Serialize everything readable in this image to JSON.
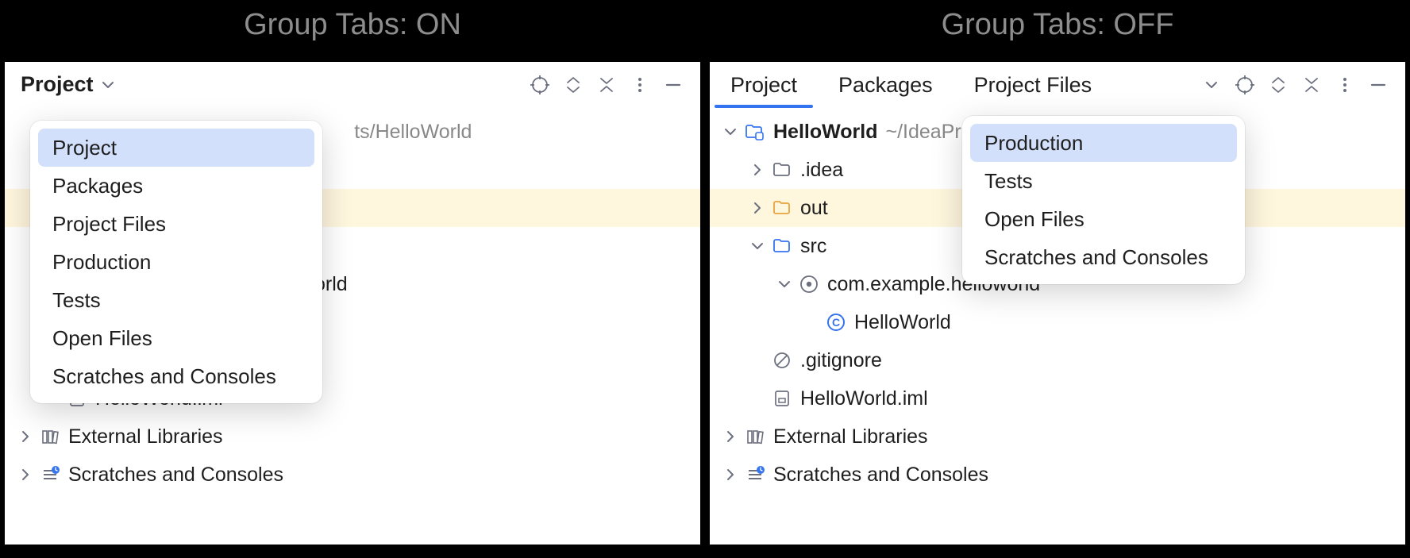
{
  "captions": {
    "left": "Group Tabs: ON",
    "right": "Group Tabs: OFF"
  },
  "left": {
    "toolbar_label": "Project",
    "popup": {
      "items": [
        "Project",
        "Packages",
        "Project Files",
        "Production",
        "Tests",
        "Open Files",
        "Scratches and Consoles"
      ],
      "selected_index": 0
    },
    "tree": {
      "root_hint_frag": "ts/HelloWorld",
      "pkg_frag": "orld",
      "iml": "HelloWorld.iml",
      "ext_lib": "External Libraries",
      "scratches": "Scratches and Consoles"
    }
  },
  "right": {
    "tabs": [
      "Project",
      "Packages",
      "Project Files"
    ],
    "active_tab_index": 0,
    "popup": {
      "items": [
        "Production",
        "Tests",
        "Open Files",
        "Scratches and Consoles"
      ],
      "selected_index": 0
    },
    "tree": {
      "root": "HelloWorld",
      "root_hint": "~/IdeaPr",
      "idea": ".idea",
      "out": "out",
      "src": "src",
      "pkg": "com.example.helloworld",
      "cls": "HelloWorld",
      "gitignore": ".gitignore",
      "iml": "HelloWorld.iml",
      "ext_lib": "External Libraries",
      "scratches": "Scratches and Consoles"
    }
  }
}
